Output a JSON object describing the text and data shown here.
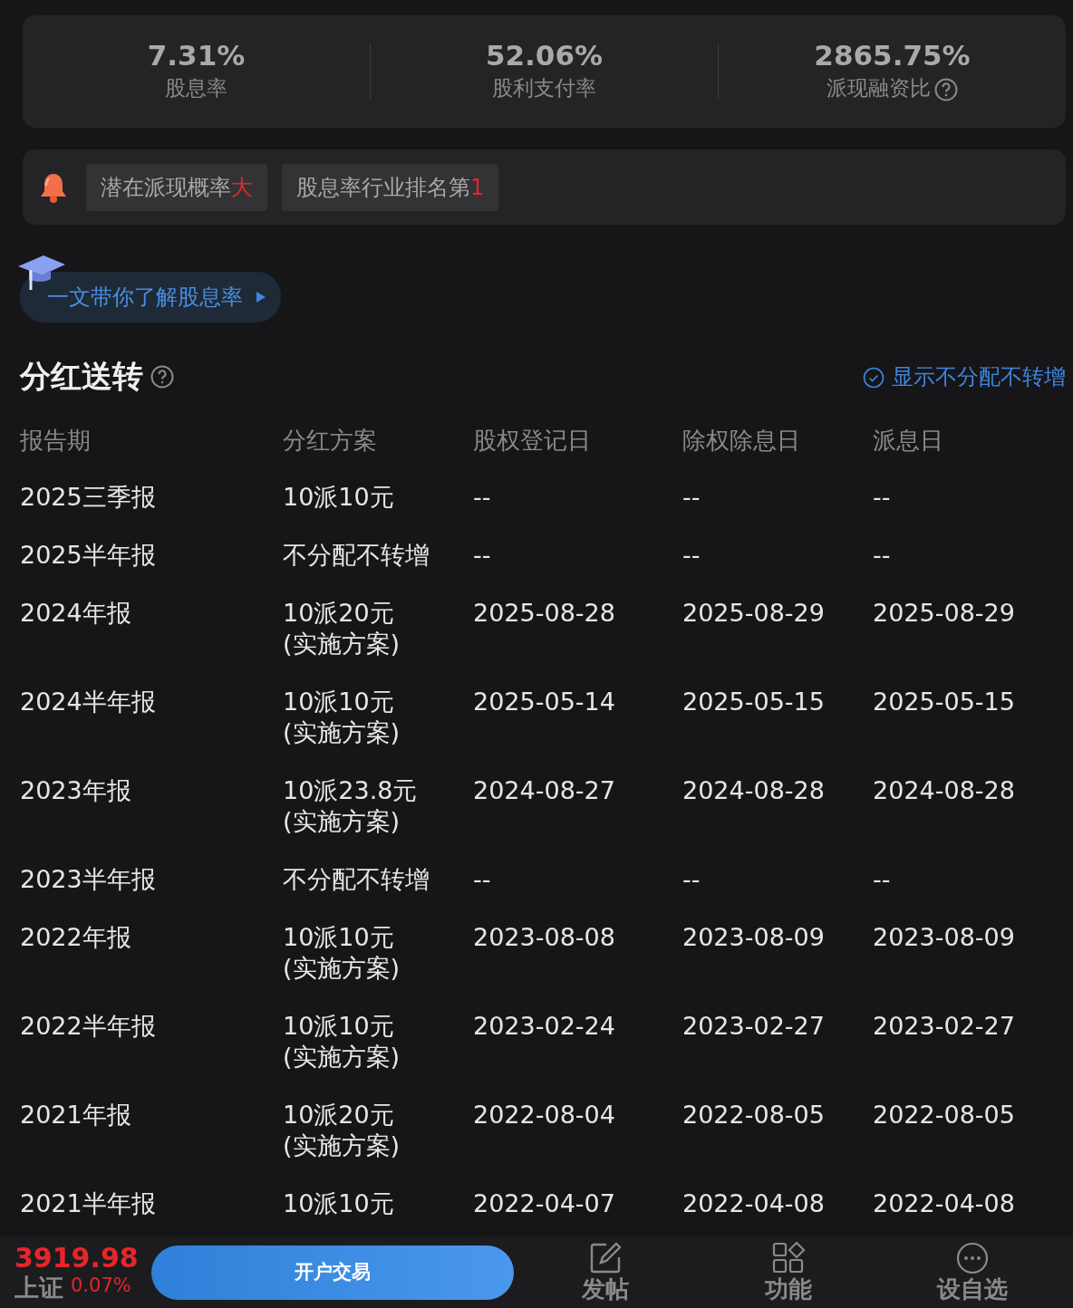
{
  "metrics": [
    {
      "value": "7.31%",
      "label": "股息率",
      "help": false
    },
    {
      "value": "52.06%",
      "label": "股利支付率",
      "help": false
    },
    {
      "value": "2865.75%",
      "label": "派现融资比",
      "help": true
    }
  ],
  "tags": [
    {
      "text": "潜在派现概率",
      "highlight": "大"
    },
    {
      "text": "股息率行业排名第",
      "highlight": "1"
    }
  ],
  "guide_link": {
    "label": "一文带你了解股息率"
  },
  "section": {
    "title": "分红送转",
    "toggle_label": "显示不分配不转增"
  },
  "table": {
    "columns": [
      "报告期",
      "分红方案",
      "股权登记日",
      "除权除息日",
      "派息日"
    ],
    "rows": [
      {
        "period": "2025三季报",
        "plan": "10派10元",
        "record_date": "--",
        "ex_date": "--",
        "pay_date": "--"
      },
      {
        "period": "2025半年报",
        "plan": "不分配不转增",
        "record_date": "--",
        "ex_date": "--",
        "pay_date": "--"
      },
      {
        "period": "2024年报",
        "plan": "10派20元",
        "plan_note": "(实施方案)",
        "record_date": "2025-08-28",
        "ex_date": "2025-08-29",
        "pay_date": "2025-08-29"
      },
      {
        "period": "2024半年报",
        "plan": "10派10元",
        "plan_note": "(实施方案)",
        "record_date": "2025-05-14",
        "ex_date": "2025-05-15",
        "pay_date": "2025-05-15"
      },
      {
        "period": "2023年报",
        "plan": "10派23.8元",
        "plan_note": "(实施方案)",
        "record_date": "2024-08-27",
        "ex_date": "2024-08-28",
        "pay_date": "2024-08-28"
      },
      {
        "period": "2023半年报",
        "plan": "不分配不转增",
        "record_date": "--",
        "ex_date": "--",
        "pay_date": "--"
      },
      {
        "period": "2022年报",
        "plan": "10派10元",
        "plan_note": "(实施方案)",
        "record_date": "2023-08-08",
        "ex_date": "2023-08-09",
        "pay_date": "2023-08-09"
      },
      {
        "period": "2022半年报",
        "plan": "10派10元",
        "plan_note": "(实施方案)",
        "record_date": "2023-02-24",
        "ex_date": "2023-02-27",
        "pay_date": "2023-02-27"
      },
      {
        "period": "2021年报",
        "plan": "10派20元",
        "plan_note": "(实施方案)",
        "record_date": "2022-08-04",
        "ex_date": "2022-08-05",
        "pay_date": "2022-08-05"
      },
      {
        "period": "2021半年报",
        "plan": "10派10元",
        "record_date": "2022-04-07",
        "ex_date": "2022-04-08",
        "pay_date": "2022-04-08"
      }
    ]
  },
  "bottom_bar": {
    "index": {
      "value": "3919.98",
      "name": "上证",
      "change": "0.07%"
    },
    "trade_button": "开户交易",
    "actions": [
      {
        "kind": "post",
        "label": "发帖"
      },
      {
        "kind": "functions",
        "label": "功能"
      },
      {
        "kind": "watchlist",
        "label": "设自选"
      }
    ]
  }
}
